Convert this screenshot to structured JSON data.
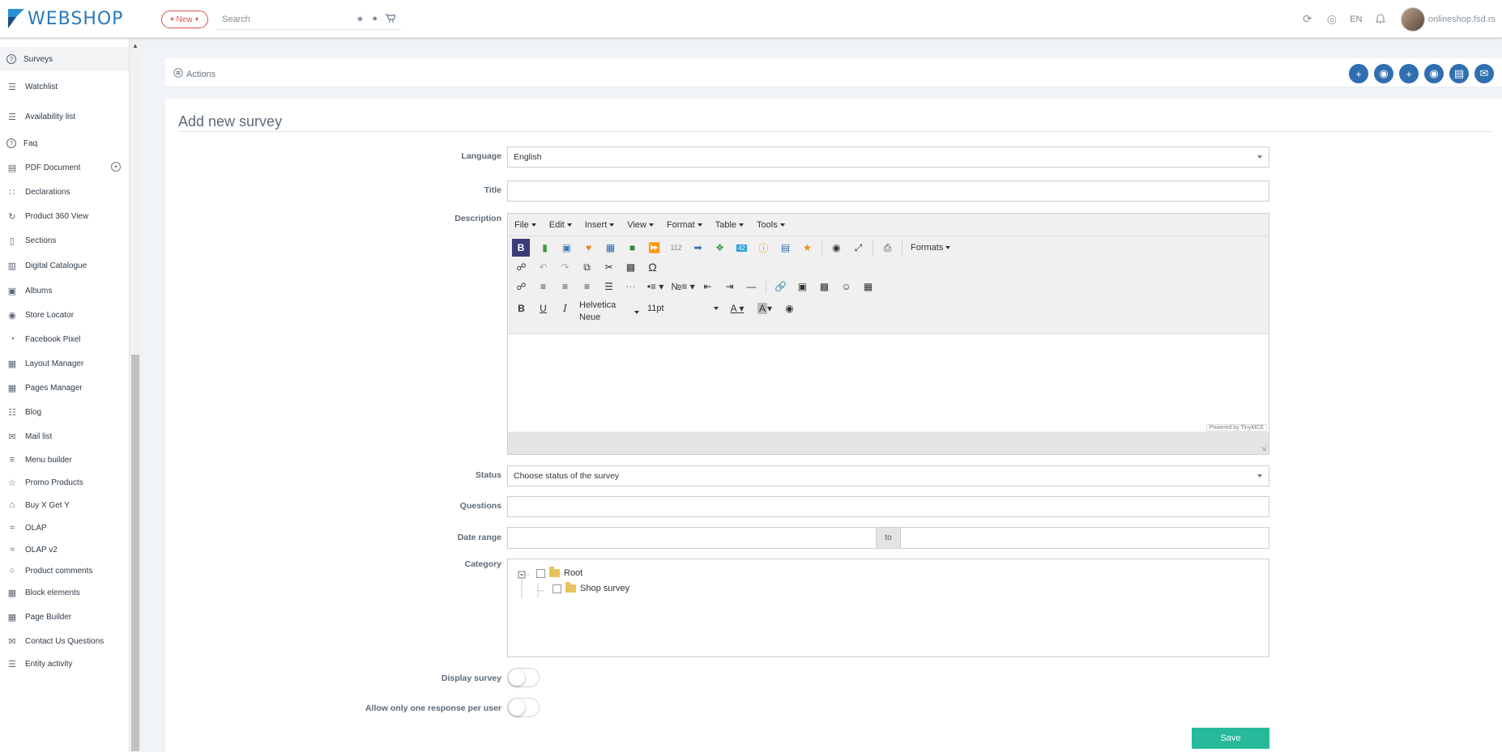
{
  "header": {
    "logo_text": "WEBSHOP",
    "new_label": "New",
    "search_placeholder": "Search",
    "language": "EN",
    "shop_name": "onlineshop.fsd.rs"
  },
  "sidebar": {
    "items": [
      {
        "label": "Surveys",
        "icon": "question-circle-icon"
      },
      {
        "label": "Watchlist",
        "icon": "watchlist-icon"
      },
      {
        "label": "Availability list",
        "icon": "availability-list-icon"
      },
      {
        "label": "Faq",
        "icon": "question-circle-icon"
      },
      {
        "label": "PDF Document",
        "icon": "pdf-document-icon"
      },
      {
        "label": "Declarations",
        "icon": "grid-icon"
      },
      {
        "label": "Product 360 View",
        "icon": "rotate-icon"
      },
      {
        "label": "Sections",
        "icon": "mobile-icon"
      },
      {
        "label": "Digital Catalogue",
        "icon": "book-icon"
      },
      {
        "label": "Albums",
        "icon": "image-icon"
      },
      {
        "label": "Store Locator",
        "icon": "map-pin-icon"
      },
      {
        "label": "Facebook Pixel",
        "icon": "pie-chart-icon"
      },
      {
        "label": "Layout Manager",
        "icon": "layout-icon"
      },
      {
        "label": "Pages Manager",
        "icon": "layout-icon"
      },
      {
        "label": "Blog",
        "icon": "blog-icon"
      },
      {
        "label": "Mail list",
        "icon": "envelope-icon"
      },
      {
        "label": "Menu builder",
        "icon": "menu-icon"
      },
      {
        "label": "Promo Products",
        "icon": "star-icon"
      },
      {
        "label": "Buy X Get Y",
        "icon": "cart-icon"
      },
      {
        "label": "OLAP",
        "icon": "layers-icon"
      },
      {
        "label": "OLAP v2",
        "icon": "layers-icon"
      },
      {
        "label": "Product comments",
        "icon": "comment-icon"
      },
      {
        "label": "Block elements",
        "icon": "layout-icon"
      },
      {
        "label": "Page Builder",
        "icon": "layout-icon"
      },
      {
        "label": "Contact Us Questions",
        "icon": "envelope-icon"
      },
      {
        "label": "Entity activity",
        "icon": "list-icon"
      }
    ]
  },
  "actions": {
    "label": "Actions"
  },
  "form": {
    "title": "Add new survey",
    "language_label": "Language",
    "language_value": "English",
    "title_label": "Title",
    "description_label": "Description",
    "status_label": "Status",
    "status_value": "Choose status of the survey",
    "questions_label": "Questions",
    "date_range_label": "Date range",
    "date_to": "to",
    "category_label": "Category",
    "display_label": "Display survey",
    "one_response_label": "Allow only one response per user",
    "save_label": "Save"
  },
  "editor": {
    "menus": [
      "File",
      "Edit",
      "Insert",
      "View",
      "Format",
      "Table",
      "Tools"
    ],
    "formats_label": "Formats",
    "font_family": "Helvetica Neue",
    "font_size": "11pt",
    "powered_by": "Powered by TinyMCE"
  },
  "category_tree": {
    "root": "Root",
    "children": [
      "Shop survey"
    ]
  }
}
